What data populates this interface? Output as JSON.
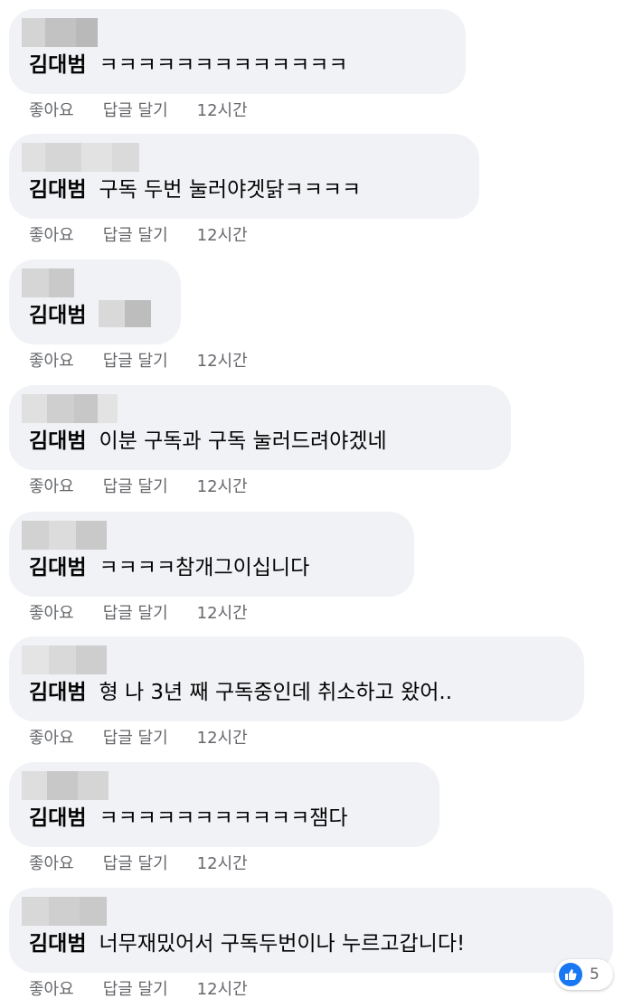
{
  "actions": {
    "like_label": "좋아요",
    "reply_label": "답글 달기",
    "time": "12시간"
  },
  "comments": [
    {
      "author": "김대범",
      "text": "ㅋㅋㅋㅋㅋㅋㅋㅋㅋㅋㅋㅋㅋ",
      "text_hidden": false
    },
    {
      "author": "김대범",
      "text": "구독 두번 눌러야겟닭ㅋㅋㅋㅋ",
      "text_hidden": false
    },
    {
      "author": "김대범",
      "text": "",
      "text_hidden": true
    },
    {
      "author": "김대범",
      "text": "이분 구독과 구독 눌러드려야겠네",
      "text_hidden": false
    },
    {
      "author": "김대범",
      "text": "ㅋㅋㅋㅋ참개그이십니다",
      "text_hidden": false
    },
    {
      "author": "김대범",
      "text": "형 나 3년 째 구독중인데 취소하고 왔어..",
      "text_hidden": false
    },
    {
      "author": "김대범",
      "text": "ㅋㅋㅋㅋㅋㅋㅋㅋㅋㅋㅋ잼다",
      "text_hidden": false
    },
    {
      "author": "김대범",
      "text": "너무재밌어서 구독두번이나 누르고갑니다!",
      "text_hidden": false
    }
  ],
  "reactions": {
    "icon": "like-icon",
    "count": "5",
    "color": "#1877f2"
  }
}
